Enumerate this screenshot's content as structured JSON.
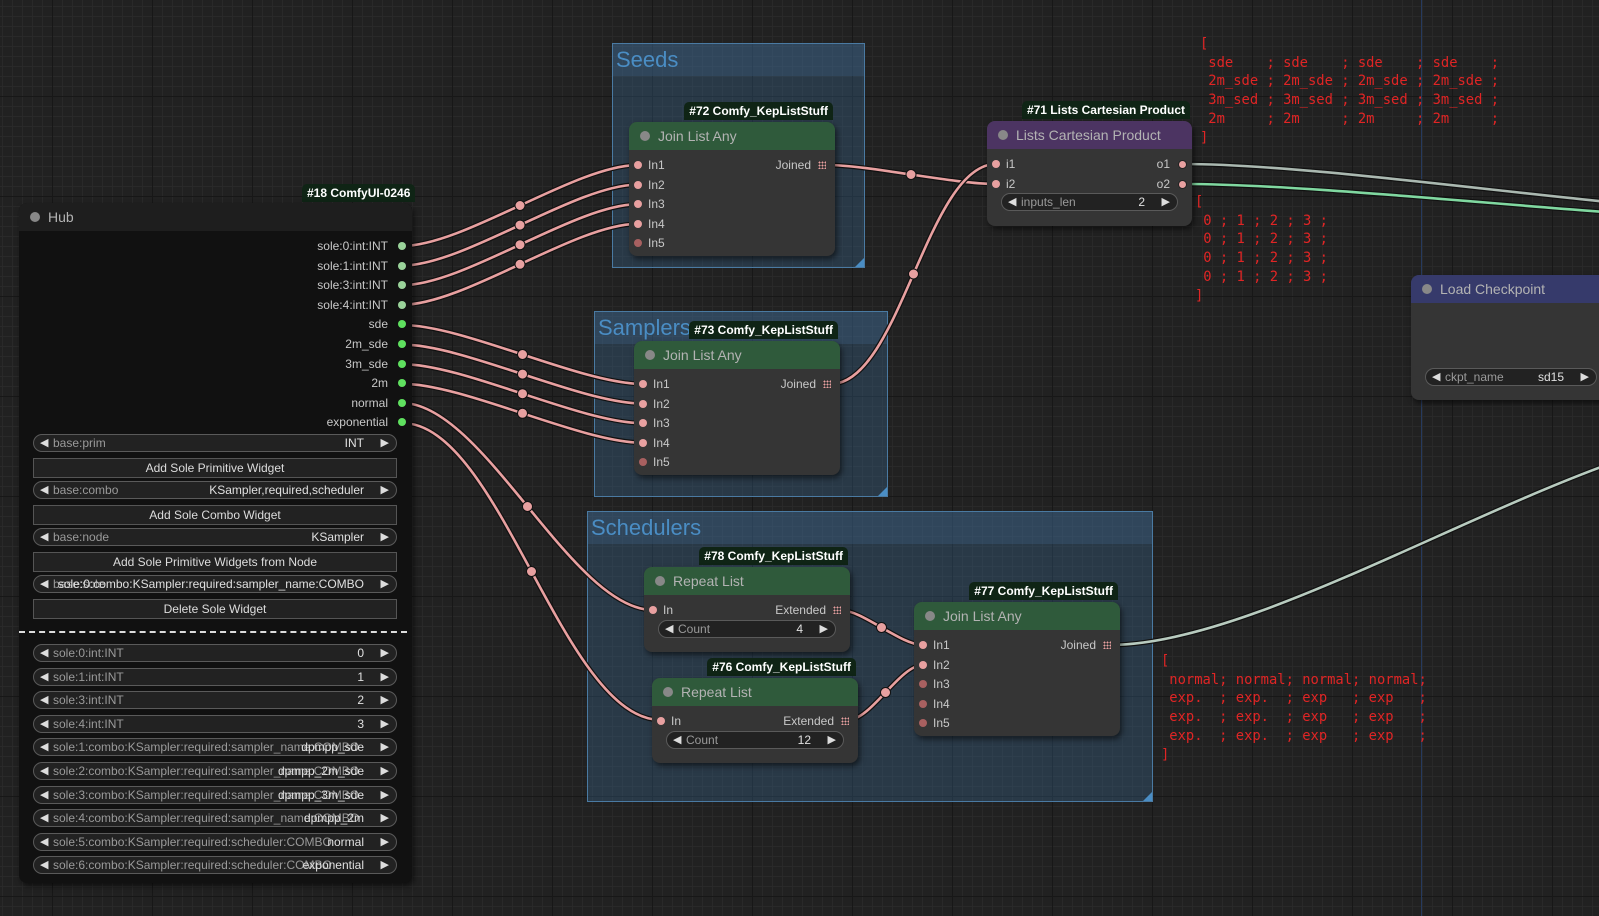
{
  "colors": {
    "link": "#e8a0a0",
    "link_gray": "#aab8b0",
    "link_green": "#80d8a0",
    "link_sage": "#b8cbbf",
    "group": "#4a8dc4",
    "node_green": "#2f5a3b",
    "node_purple": "#4c3462",
    "node_blue": "#363a6b",
    "note_text": "#e02525",
    "int_dot": "#9ad39a",
    "combo_dot": "#5fe05f"
  },
  "groups": {
    "seeds": "Seeds",
    "samplers": "Samplers",
    "schedulers": "Schedulers"
  },
  "hub": {
    "badge": "#18 ComfyUI-0246",
    "title": "Hub",
    "outputs": [
      "sole:0:int:INT",
      "sole:1:int:INT",
      "sole:3:int:INT",
      "sole:4:int:INT",
      "sde",
      "2m_sde",
      "3m_sde",
      "2m",
      "normal",
      "exponential"
    ],
    "controls": [
      {
        "type": "widget",
        "label": "base:prim",
        "value": "INT"
      },
      {
        "type": "button",
        "label": "Add Sole Primitive Widget"
      },
      {
        "type": "widget",
        "label": "base:combo",
        "value": "KSampler,required,scheduler"
      },
      {
        "type": "button",
        "label": "Add Sole Combo Widget"
      },
      {
        "type": "widget",
        "label": "base:node",
        "value": "KSampler"
      },
      {
        "type": "button",
        "label": "Add Sole Primitive Widgets from Node"
      },
      {
        "type": "widget",
        "label": "base:sole",
        "value": "sole:0:combo:KSampler:required:sampler_name:COMBO"
      },
      {
        "type": "button",
        "label": "Delete Sole Widget"
      }
    ],
    "sole_widgets": [
      {
        "label": "sole:0:int:INT",
        "value": "0"
      },
      {
        "label": "sole:1:int:INT",
        "value": "1"
      },
      {
        "label": "sole:3:int:INT",
        "value": "2"
      },
      {
        "label": "sole:4:int:INT",
        "value": "3"
      },
      {
        "label": "sole:1:combo:KSampler:required:sampler_name:COMBO",
        "value": "dpmpp_sde"
      },
      {
        "label": "sole:2:combo:KSampler:required:sampler_name:COMBO",
        "value": "dpmpp_2m_sde"
      },
      {
        "label": "sole:3:combo:KSampler:required:sampler_name:COMBO",
        "value": "dpmpp_3m_sde"
      },
      {
        "label": "sole:4:combo:KSampler:required:sampler_name:COMBO",
        "value": "dpmpp_2m"
      },
      {
        "label": "sole:5:combo:KSampler:required:scheduler:COMBO",
        "value": "normal"
      },
      {
        "label": "sole:6:combo:KSampler:required:scheduler:COMBO",
        "value": "exponential"
      }
    ]
  },
  "nodes": {
    "n72": {
      "badge": "#72 Comfy_KepListStuff",
      "title": "Join List Any",
      "inputs": [
        "In1",
        "In2",
        "In3",
        "In4",
        "In5"
      ],
      "output": "Joined"
    },
    "n73": {
      "badge": "#73 Comfy_KepListStuff",
      "title": "Join List Any",
      "inputs": [
        "In1",
        "In2",
        "In3",
        "In4",
        "In5"
      ],
      "output": "Joined"
    },
    "n71": {
      "badge": "#71 Lists Cartesian Product",
      "title": "Lists Cartesian Product",
      "inputs": [
        "i1",
        "i2"
      ],
      "outputs": [
        "o1",
        "o2"
      ],
      "widget": {
        "label": "inputs_len",
        "value": "2"
      }
    },
    "n78": {
      "badge": "#78 Comfy_KepListStuff",
      "title": "Repeat List",
      "inputs": [
        "In"
      ],
      "output": "Extended",
      "widget": {
        "label": "Count",
        "value": "4"
      }
    },
    "n76": {
      "badge": "#76 Comfy_KepListStuff",
      "title": "Repeat List",
      "inputs": [
        "In"
      ],
      "output": "Extended",
      "widget": {
        "label": "Count",
        "value": "12"
      }
    },
    "n77": {
      "badge": "#77 Comfy_KepListStuff",
      "title": "Join List Any",
      "inputs": [
        "In1",
        "In2",
        "In3",
        "In4",
        "In5"
      ],
      "output": "Joined"
    },
    "ckpt": {
      "title": "Load Checkpoint",
      "widget": {
        "label": "ckpt_name",
        "value": "sd15"
      }
    }
  },
  "notes": {
    "samplers_preview": "[\n sde    ; sde    ; sde    ; sde    ;\n 2m_sde ; 2m_sde ; 2m_sde ; 2m_sde ;\n 3m_sed ; 3m_sed ; 3m_sed ; 3m_sed ;\n 2m     ; 2m     ; 2m     ; 2m     ;\n]",
    "seeds_preview": "[\n 0 ; 1 ; 2 ; 3 ;\n 0 ; 1 ; 2 ; 3 ;\n 0 ; 1 ; 2 ; 3 ;\n 0 ; 1 ; 2 ; 3 ;\n]",
    "schedulers_preview": "[\n normal; normal; normal; normal;\n exp.  ; exp.  ; exp   ; exp   ;\n exp.  ; exp.  ; exp   ; exp   ;\n exp.  ; exp.  ; exp   ; exp   ;\n]"
  },
  "icons": {
    "node_collapse": "circle-dot",
    "widget_decrement": "triangle-left",
    "widget_increment": "triangle-right",
    "list_output": "grid-icon"
  }
}
